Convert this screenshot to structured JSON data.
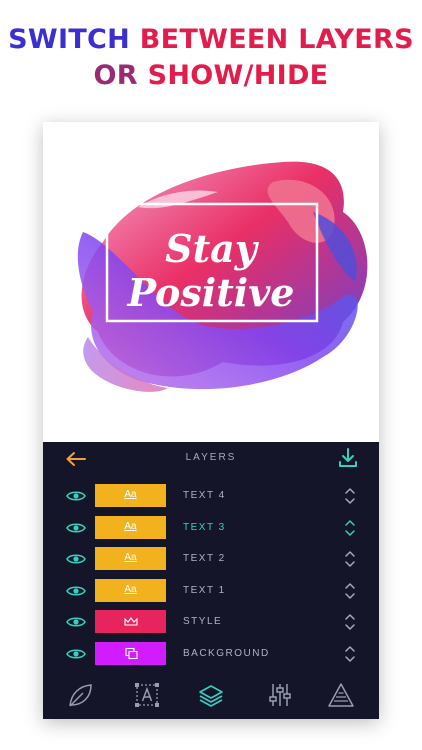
{
  "headline": {
    "line1_part1": "SWITCH ",
    "line1_part2": "BETWEEN LAYERS",
    "line2_part1": "OR ",
    "line2_part2": "SHOW/HIDE"
  },
  "colors": {
    "headline_blue": "#3b2fd0",
    "headline_red": "#e21d4c",
    "headline_dark": "#9a2b73",
    "panel_bg": "#141528",
    "accent_teal": "#35d0c2",
    "accent_orange": "#f2a23a",
    "text_thumb_yellow": "#f2b21e",
    "style_thumb_pink": "#e8245e",
    "background_thumb_magenta": "#d11cff"
  },
  "artwork": {
    "line1": "Stay",
    "line2": "Positive"
  },
  "panel": {
    "title": "LAYERS",
    "back_icon": "arrow-left-icon",
    "download_icon": "download-icon"
  },
  "layers": [
    {
      "name": "TEXT 4",
      "thumb_label": "Aa",
      "thumb_color": "#f2b21e",
      "visible": true,
      "active": false
    },
    {
      "name": "TEXT 3",
      "thumb_label": "Aa",
      "thumb_color": "#f2b21e",
      "visible": true,
      "active": true
    },
    {
      "name": "TEXT 2",
      "thumb_label": "Aa",
      "thumb_color": "#f2b21e",
      "visible": true,
      "active": false
    },
    {
      "name": "TEXT 1",
      "thumb_label": "Aa",
      "thumb_color": "#f2b21e",
      "visible": true,
      "active": false
    },
    {
      "name": "STYLE",
      "thumb_label": "",
      "thumb_color": "#e8245e",
      "visible": true,
      "active": false
    },
    {
      "name": "BACKGROUND",
      "thumb_label": "",
      "thumb_color": "#d11cff",
      "visible": true,
      "active": false
    }
  ],
  "toolbar": [
    {
      "icon": "leaf-icon",
      "active": false
    },
    {
      "icon": "text-frame-icon",
      "active": false
    },
    {
      "icon": "layers-icon",
      "active": true
    },
    {
      "icon": "sliders-icon",
      "active": false
    },
    {
      "icon": "triangle-icon",
      "active": false
    }
  ]
}
